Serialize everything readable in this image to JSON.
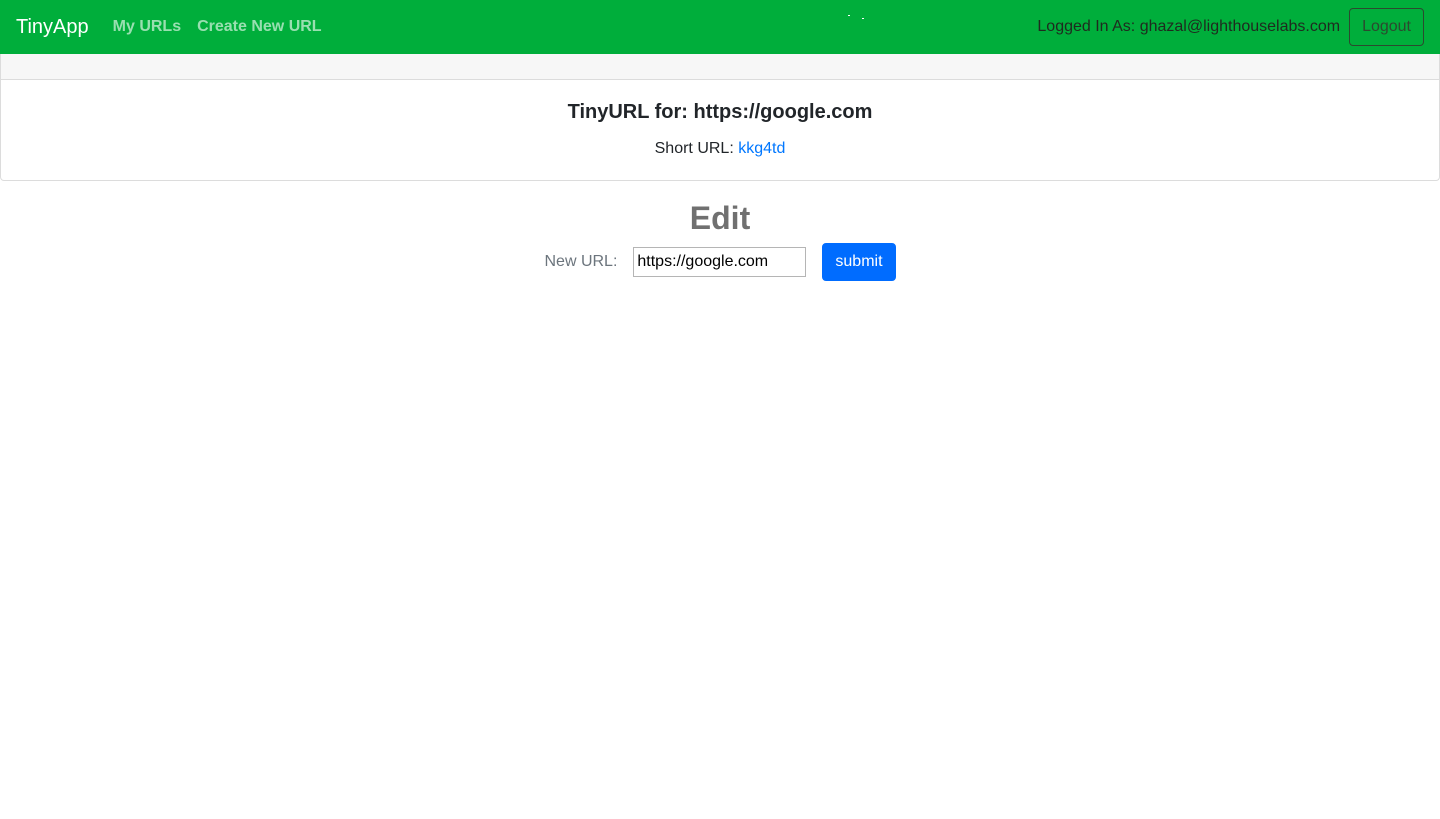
{
  "navbar": {
    "brand": "TinyApp",
    "links": [
      {
        "label": "My URLs"
      },
      {
        "label": "Create New URL"
      }
    ],
    "logged_in_text": "Logged In As: ghazal@lighthouselabs.com",
    "logout_label": "Logout"
  },
  "card": {
    "title": "TinyURL for: https://google.com",
    "short_url_label": "Short URL:",
    "short_url_value": "kkg4td"
  },
  "edit": {
    "heading": "Edit",
    "new_url_label": "New URL:",
    "new_url_value": "https://google.com",
    "submit_label": "submit"
  },
  "colors": {
    "navbar_bg": "#00ae3b",
    "link_blue": "#0077ff",
    "submit_bg": "#006cff"
  }
}
